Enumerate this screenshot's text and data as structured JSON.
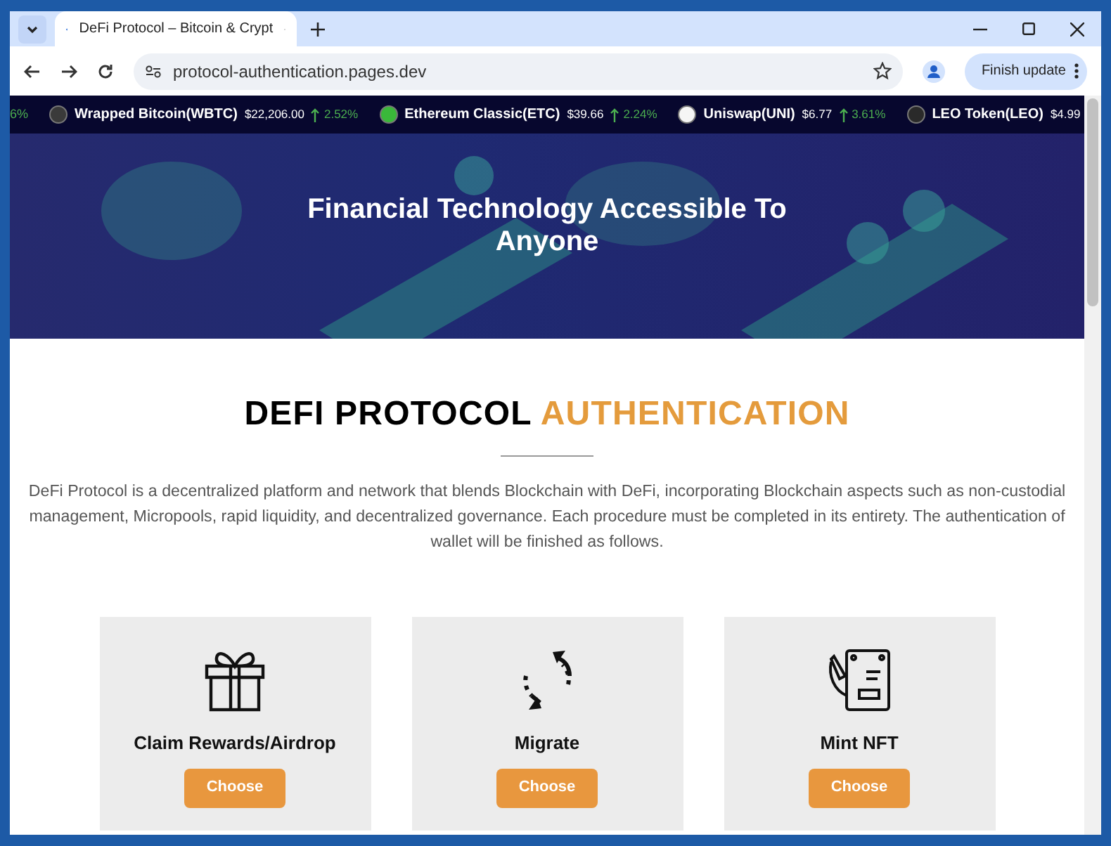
{
  "browser": {
    "tab_title": "DeFi Protocol – Bitcoin & Crypt",
    "url": "protocol-authentication.pages.dev",
    "update_button": "Finish update"
  },
  "ticker": [
    {
      "kind": "partial",
      "change": "6%"
    },
    {
      "kind": "coin",
      "name": "Wrapped Bitcoin(WBTC)",
      "price": "$22,206.00",
      "change": "2.52%",
      "color": "#3a3a3a"
    },
    {
      "kind": "coin",
      "name": "Ethereum Classic(ETC)",
      "price": "$39.66",
      "change": "2.24%",
      "color": "#3ab83a"
    },
    {
      "kind": "coin",
      "name": "Uniswap(UNI)",
      "price": "$6.77",
      "change": "3.61%",
      "color": "#f5f5f5"
    },
    {
      "kind": "coin",
      "name": "LEO Token(LEO)",
      "price": "$4.99",
      "color": "#2a2a2a"
    }
  ],
  "hero": {
    "title": "Financial Technology Accessible To Anyone"
  },
  "heading": {
    "dark": "DEFI PROTOCOL",
    "accent": "AUTHENTICATION"
  },
  "intro": "DeFi Protocol is a decentralized platform and network that blends Blockchain with DeFi, incorporating Blockchain aspects such as non-custodial management, Micropools, rapid liquidity, and decentralized governance. Each procedure must be completed in its entirety. The authentication of wallet will be finished as follows.",
  "cards": [
    {
      "kind": "gift",
      "title": "Claim Rewards/Airdrop",
      "button": "Choose"
    },
    {
      "kind": "migrate",
      "title": "Migrate",
      "button": "Choose"
    },
    {
      "kind": "nft",
      "title": "Mint NFT",
      "button": "Choose"
    }
  ]
}
